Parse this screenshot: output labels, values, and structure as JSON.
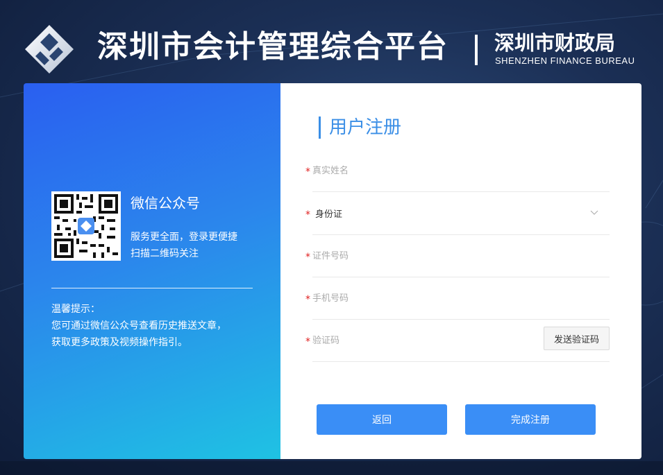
{
  "header": {
    "title": "深圳市会计管理综合平台",
    "bureau_cn": "深圳市财政局",
    "bureau_en": "SHENZHEN FINANCE BUREAU"
  },
  "wechat": {
    "title": "微信公众号",
    "desc_line1": "服务更全面，登录更便捷",
    "desc_line2": "扫描二维码关注"
  },
  "tips": {
    "title": "温馨提示：",
    "line1": "您可通过微信公众号查看历史推送文章，",
    "line2": "获取更多政策及视频操作指引。"
  },
  "form": {
    "title": "用户注册",
    "required_mark": "*",
    "real_name_placeholder": "真实姓名",
    "id_type_value": "身份证",
    "id_number_placeholder": "证件号码",
    "phone_placeholder": "手机号码",
    "code_placeholder": "验证码",
    "send_code_label": "发送验证码",
    "back_label": "返回",
    "submit_label": "完成注册"
  },
  "colors": {
    "accent": "#3a8ef6",
    "required": "#e02020"
  }
}
